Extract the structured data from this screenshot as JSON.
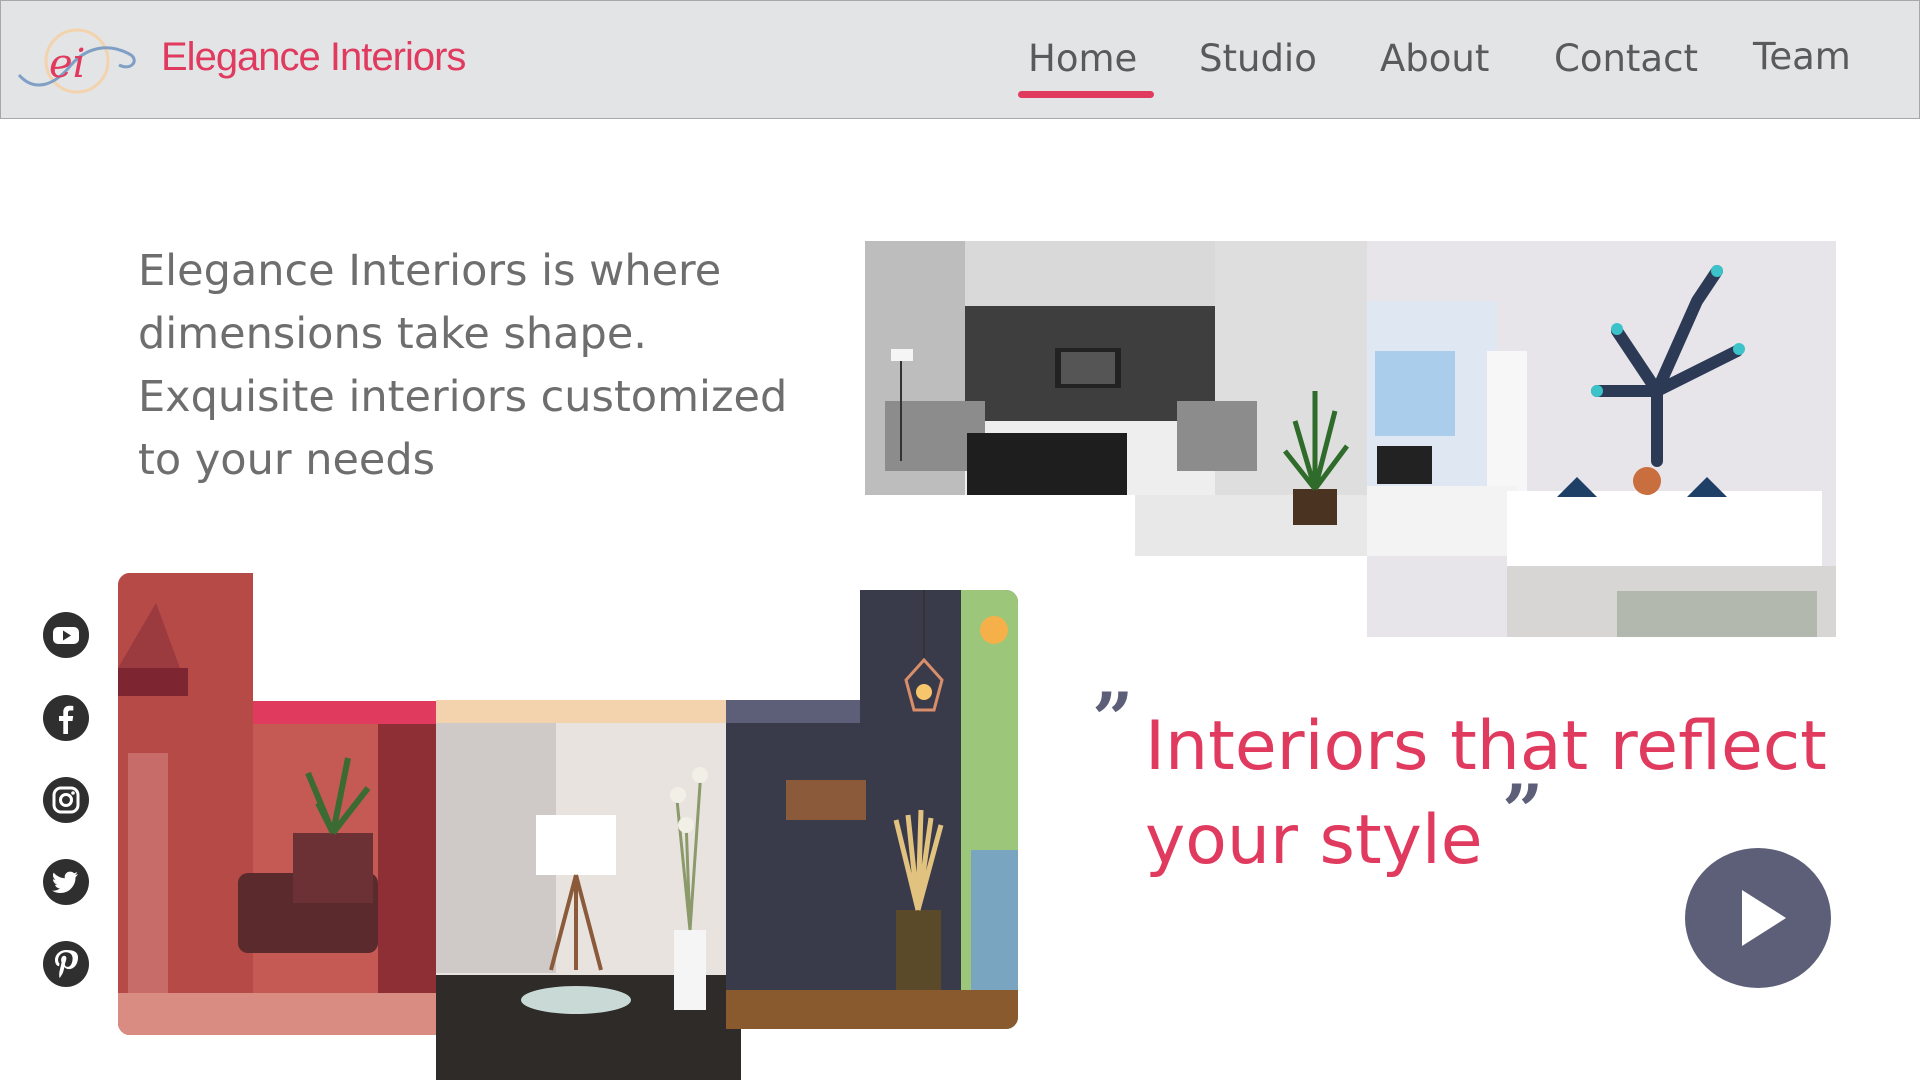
{
  "brand": {
    "logo_text": "ei",
    "name": "Elegance Interiors"
  },
  "nav": {
    "items": [
      {
        "label": "Home",
        "active": true
      },
      {
        "label": "Studio",
        "active": false
      },
      {
        "label": "About",
        "active": false
      },
      {
        "label": "Contact",
        "active": false
      },
      {
        "label": "Team",
        "active": false
      }
    ]
  },
  "hero": {
    "intro_lines": [
      "Elegance Interiors is where",
      "dimensions take shape.",
      "Exquisite interiors customized",
      "to your needs"
    ]
  },
  "social": [
    {
      "icon": "youtube-icon"
    },
    {
      "icon": "facebook-icon"
    },
    {
      "icon": "instagram-icon"
    },
    {
      "icon": "twitter-icon"
    },
    {
      "icon": "pinterest-icon"
    }
  ],
  "quote": {
    "lines": [
      "Interiors that reflect",
      "your style"
    ],
    "open_mark": "”",
    "close_mark": "”"
  },
  "colors": {
    "accent": "#e03a5f",
    "slate": "#5d5f79",
    "peach": "#f3d3ad",
    "header_bg": "#e3e4e6"
  }
}
